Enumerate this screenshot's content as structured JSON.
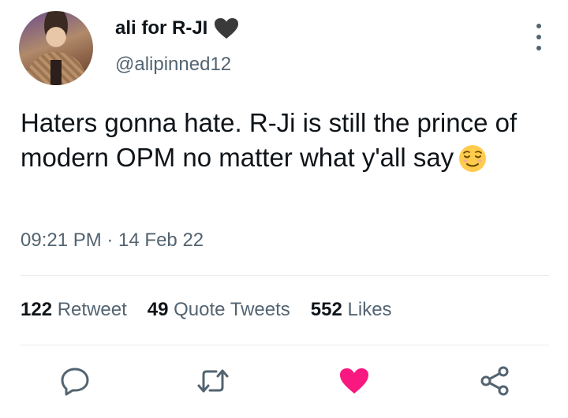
{
  "author": {
    "display_name": "ali for R-JI",
    "handle": "@alipinned12",
    "badge_icon": "black-heart-icon"
  },
  "tweet": {
    "text": "Haters gonna hate. R-Ji is still the prince of modern OPM no matter what y'all say",
    "emoji": "relieved-face-emoji",
    "timestamp": "09:21 PM · 14 Feb 22"
  },
  "stats": {
    "retweets_count": "122",
    "retweets_label": "Retweet",
    "quotes_count": "49",
    "quotes_label": "Quote Tweets",
    "likes_count": "552",
    "likes_label": "Likes"
  },
  "actions": {
    "reply_icon": "reply-icon",
    "retweet_icon": "retweet-icon",
    "like_icon": "heart-icon",
    "share_icon": "share-icon",
    "like_color": "#f91880",
    "icon_color": "#536471"
  }
}
